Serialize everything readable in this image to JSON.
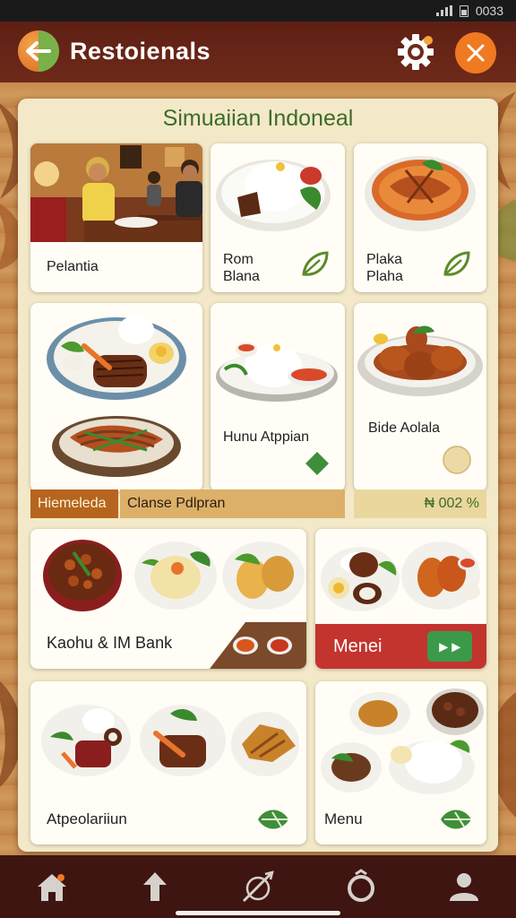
{
  "status_bar": {
    "time": "0033"
  },
  "header": {
    "title": "Restoienals",
    "back_icon": "back-arrow-icon",
    "settings_icon": "gear-icon",
    "close_icon": "close-icon"
  },
  "panel": {
    "title": "Simuaiian Indoneal"
  },
  "cards": {
    "c1": {
      "label": "Pelantia"
    },
    "c2": {
      "label": "Rom\nBlana"
    },
    "c3": {
      "label": "Plaka\nPlaha"
    },
    "c5": {
      "label": "Hunu Atppian"
    },
    "c6": {
      "label": "Bide Aolala"
    },
    "c7": {
      "label": "Kaohu & IM Bank"
    },
    "c8": {
      "menu_label": "Menei",
      "go_label": "▸ ▸"
    },
    "c9": {
      "label": "Atpeolariiun"
    },
    "c10": {
      "label": "Menu"
    }
  },
  "strip": {
    "tag_left": "Hiemeleda",
    "tag_middle": "Clanse Pdlpran",
    "tag_right": "₦ 002 %"
  },
  "bottom_nav": [
    {
      "name": "home",
      "icon": "home-icon"
    },
    {
      "name": "up",
      "icon": "arrow-up-icon"
    },
    {
      "name": "tools",
      "icon": "compass-icon"
    },
    {
      "name": "ring",
      "icon": "ring-icon"
    },
    {
      "name": "profile",
      "icon": "person-icon"
    }
  ],
  "colors": {
    "header": "#6e2a19",
    "accent_orange": "#ef7a22",
    "panel": "#f3e9c9",
    "title_green": "#3d6b2a",
    "menu_red": "#c3342e",
    "go_green": "#3b9a4a"
  }
}
